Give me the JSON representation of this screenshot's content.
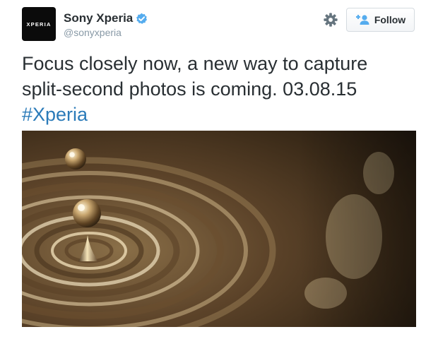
{
  "account": {
    "avatar_text": "XPERIA",
    "display_name": "Sony Xperia",
    "handle": "@sonyxperia",
    "verified": true
  },
  "actions": {
    "settings_icon": "gear-icon",
    "follow_icon": "add-user-icon",
    "follow_label": "Follow"
  },
  "tweet": {
    "line1": "Focus closely now, a new way to capture",
    "line2": "split-second photos is coming. 03.08.15",
    "hashtag": "#Xperia"
  },
  "colors": {
    "link": "#2b7bb9",
    "verified": "#55acee",
    "text": "#292f33",
    "muted": "#8899a6"
  }
}
